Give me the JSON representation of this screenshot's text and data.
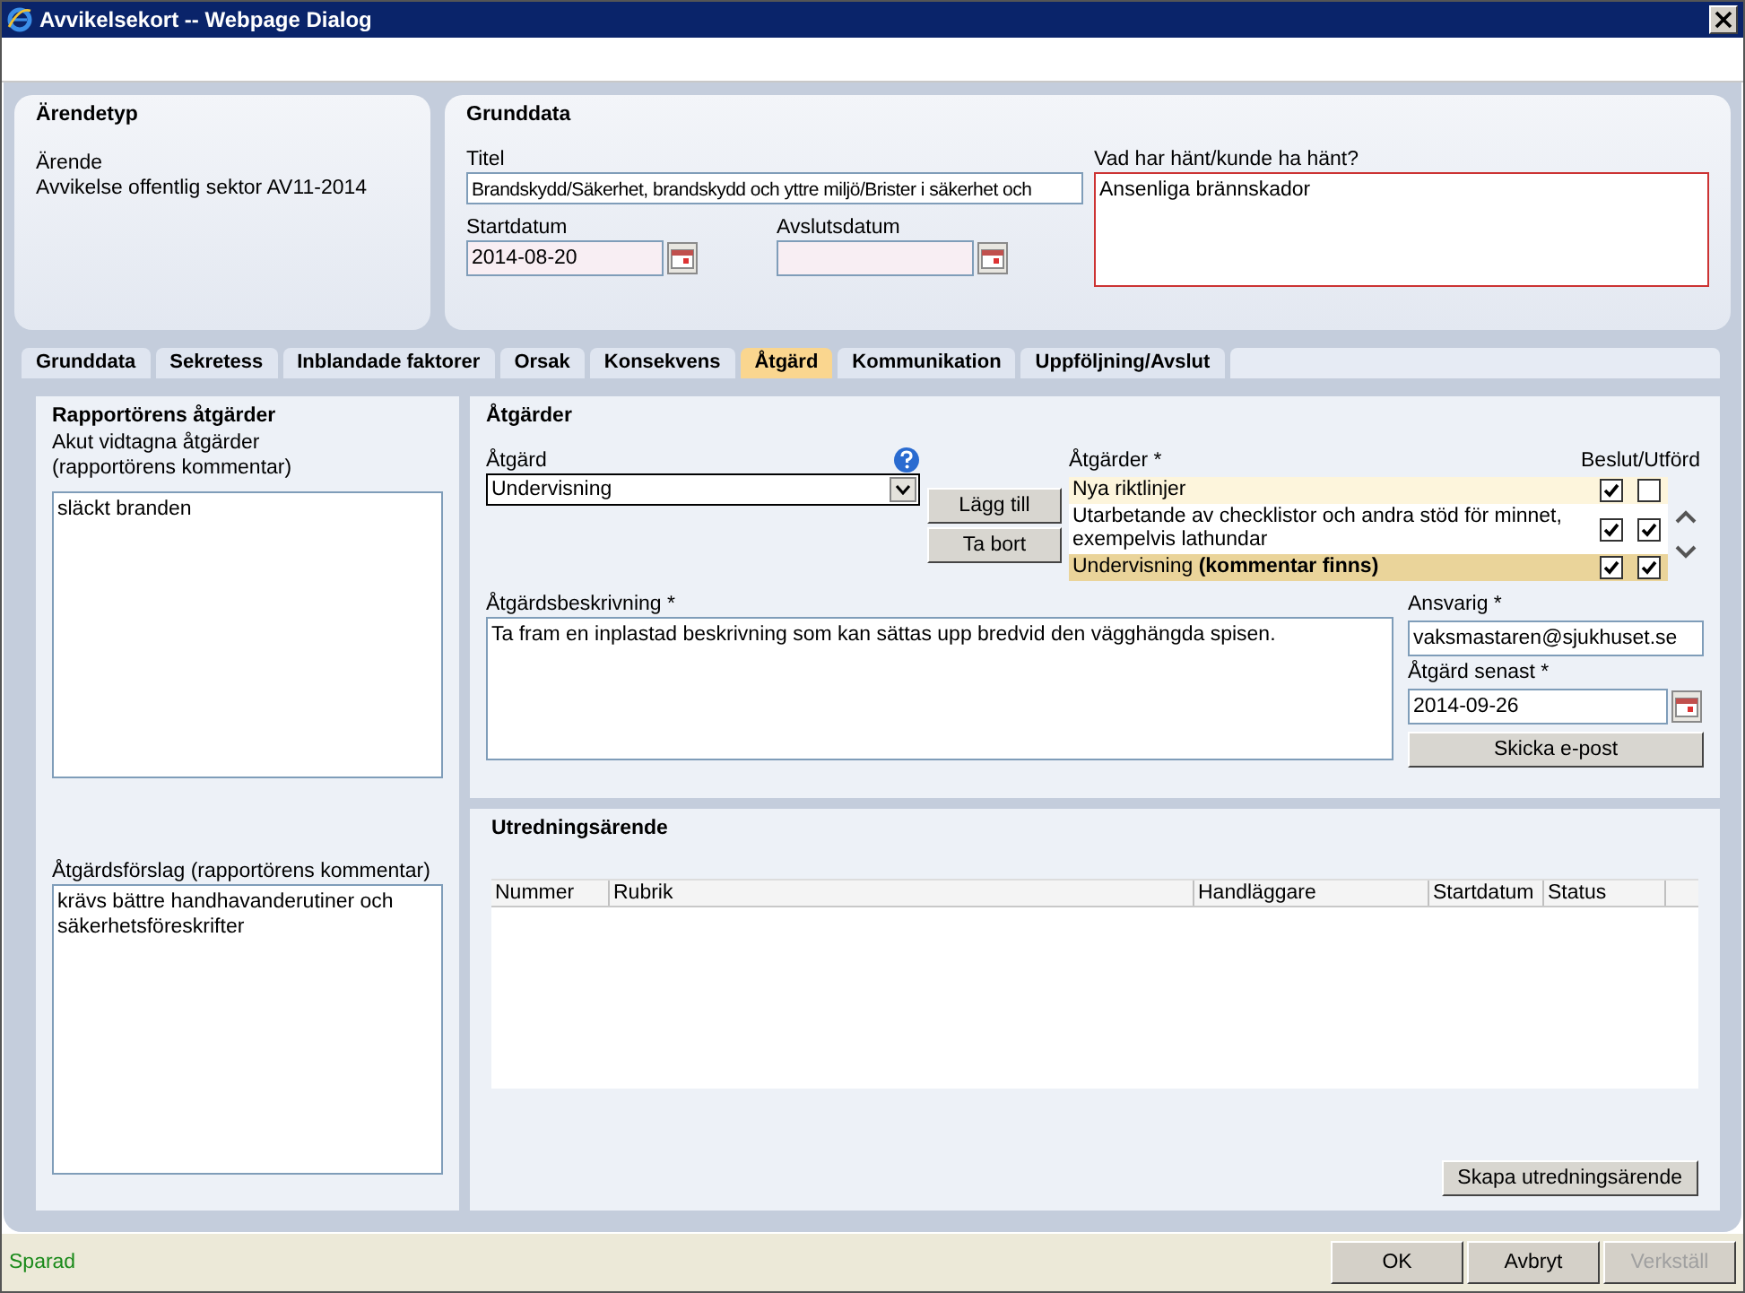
{
  "window": {
    "title": "Avvikelsekort -- Webpage Dialog"
  },
  "case_type": {
    "heading": "Ärendetyp",
    "label": "Ärende",
    "value": "Avvikelse offentlig sektor AV11-2014"
  },
  "basic_data": {
    "heading": "Grunddata",
    "title_label": "Titel",
    "title_value": "Brandskydd/Säkerhet, brandskydd och yttre miljö/Brister i säkerhet och",
    "start_label": "Startdatum",
    "start_value": "2014-08-20",
    "end_label": "Avslutsdatum",
    "what_label": "Vad har hänt/kunde ha hänt?",
    "what_value": "Ansenliga brännskador"
  },
  "tabs": [
    {
      "label": "Grunddata",
      "selected": false
    },
    {
      "label": "Sekretess",
      "selected": false
    },
    {
      "label": "Inblandade faktorer",
      "selected": false
    },
    {
      "label": "Orsak",
      "selected": false
    },
    {
      "label": "Konsekvens",
      "selected": false
    },
    {
      "label": "Åtgärd",
      "selected": true
    },
    {
      "label": "Kommunikation",
      "selected": false
    },
    {
      "label": "Uppföljning/Avslut",
      "selected": false
    }
  ],
  "reporter": {
    "heading": "Rapportörens åtgärder",
    "acute_label": "Akut vidtagna åtgärder (rapportörens kommentar)",
    "acute_value": "släckt branden",
    "proposal_label": "Åtgärdsförslag (rapportörens kommentar)",
    "proposal_value": "krävs bättre handhavanderutiner och säkerhetsföreskrifter"
  },
  "actions": {
    "heading": "Åtgärder",
    "action_label": "Åtgärd",
    "action_value": "Undervisning",
    "add_button": "Lägg till",
    "remove_button": "Ta bort",
    "list_label": "Åtgärder *",
    "list_columns": "Beslut/Utförd",
    "items": [
      {
        "text": "Nya riktlinjer",
        "decided": true,
        "done": false,
        "selected": false
      },
      {
        "text": "Utarbetande av checklistor och andra stöd för minnet, exempelvis lathundar",
        "decided": true,
        "done": true,
        "selected": false
      },
      {
        "text": "Undervisning **(kommentar finns)**",
        "decided": true,
        "done": true,
        "selected": true
      }
    ],
    "description_label": "Åtgärdsbeskrivning *",
    "description_value": "Ta fram en inplastad beskrivning som kan sättas upp bredvid den vägghängda spisen.",
    "responsible_label": "Ansvarig *",
    "responsible_value": "vaksmastaren@sjukhuset.se",
    "deadline_label": "Åtgärd senast *",
    "deadline_value": "2014-09-26",
    "email_button": "Skicka e-post"
  },
  "investigation": {
    "heading": "Utredningsärende",
    "columns": [
      "Nummer",
      "Rubrik",
      "Handläggare",
      "Startdatum",
      "Status"
    ],
    "create_button": "Skapa utredningsärende"
  },
  "status_bar": {
    "status": "Sparad",
    "buttons": [
      {
        "label": "OK",
        "disabled": false
      },
      {
        "label": "Avbryt",
        "disabled": false
      },
      {
        "label": "Verkställ",
        "disabled": true
      }
    ]
  }
}
